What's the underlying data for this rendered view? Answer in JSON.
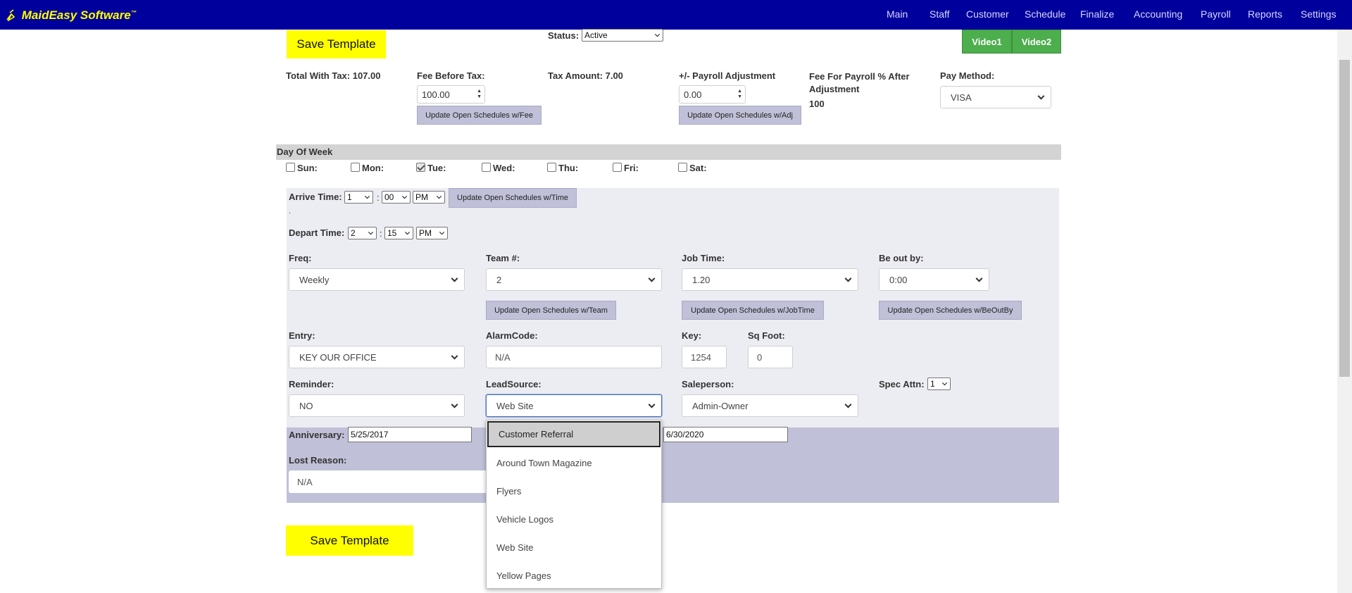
{
  "app": {
    "logo_text": "MaidEasy Software",
    "logo_tm": "™",
    "nav": [
      "Main",
      "Staff",
      "Customer",
      "Schedule",
      "Finalize",
      "Accounting",
      "Payroll",
      "Reports",
      "Settings"
    ]
  },
  "colors": {
    "nav_bg": "#00009c",
    "logo": "#ffff00",
    "save_button": "#ffff00",
    "video_button": "#4cae4c",
    "secondary_button": "#c0c0d8"
  },
  "header": {
    "save_label": "Save Template",
    "status_label": "Status:",
    "status_value": "Active",
    "video1": "Video1",
    "video2": "Video2"
  },
  "fees": {
    "total_with_tax_label": "Total With Tax: 107.00",
    "fee_before_tax_label": "Fee Before Tax:",
    "fee_before_tax_value": "100.00",
    "update_fee_button": "Update Open Schedules w/Fee",
    "tax_amount_label": "Tax Amount: 7.00",
    "payroll_adj_label": "+/- Payroll Adjustment",
    "payroll_adj_value": "0.00",
    "update_adj_button": "Update Open Schedules w/Adj",
    "fee_for_payroll_label": "Fee For Payroll % After Adjustment",
    "fee_for_payroll_value": "100",
    "pay_method_label": "Pay Method:",
    "pay_method_value": "VISA"
  },
  "days": {
    "header": "Day Of Week",
    "items": [
      {
        "label": "Sun:",
        "checked": false
      },
      {
        "label": "Mon:",
        "checked": false
      },
      {
        "label": "Tue:",
        "checked": true
      },
      {
        "label": "Wed:",
        "checked": false
      },
      {
        "label": "Thu:",
        "checked": false
      },
      {
        "label": "Fri:",
        "checked": false
      },
      {
        "label": "Sat:",
        "checked": false
      }
    ]
  },
  "times": {
    "arrive_label": "Arrive Time:",
    "arrive_hour": "1",
    "arrive_min": "00",
    "arrive_ampm": "PM",
    "colon": ":",
    "update_time_button": "Update Open Schedules w/Time",
    "dot": ".",
    "depart_label": "Depart Time:",
    "depart_hour": "2",
    "depart_min": "15",
    "depart_ampm": "PM"
  },
  "fields": {
    "freq_label": "Freq:",
    "freq_value": "Weekly",
    "team_label": "Team #:",
    "team_value": "2",
    "update_team_button": "Update Open Schedules w/Team",
    "jobtime_label": "Job Time:",
    "jobtime_value": "1.20",
    "update_jobtime_button": "Update Open Schedules w/JobTime",
    "beoutby_label": "Be out by:",
    "beoutby_value": "0:00",
    "update_beoutby_button": "Update Open Schedules w/BeOutBy",
    "entry_label": "Entry:",
    "entry_value": "KEY OUR OFFICE",
    "alarm_label": "AlarmCode:",
    "alarm_value": "N/A",
    "key_label": "Key:",
    "key_value": "1254",
    "sqft_label": "Sq Foot:",
    "sqft_value": "0",
    "reminder_label": "Reminder:",
    "reminder_value": "NO",
    "leadsource_label": "LeadSource:",
    "leadsource_value": "Web Site",
    "salesperson_label": "Saleperson:",
    "salesperson_value": "Admin-Owner",
    "specattn_label": "Spec Attn:",
    "specattn_value": "1",
    "anniversary_label": "Anniversary:",
    "anniversary_value": "5/25/2017",
    "other_date_value": "6/30/2020",
    "lost_reason_label": "Lost Reason:",
    "lost_reason_value": "N/A"
  },
  "leadsource_dropdown": {
    "options": [
      "Customer Referral",
      "Around Town Magazine",
      "Flyers",
      "Vehicle Logos",
      "Web Site",
      "Yellow Pages"
    ],
    "highlighted": "Customer Referral"
  }
}
